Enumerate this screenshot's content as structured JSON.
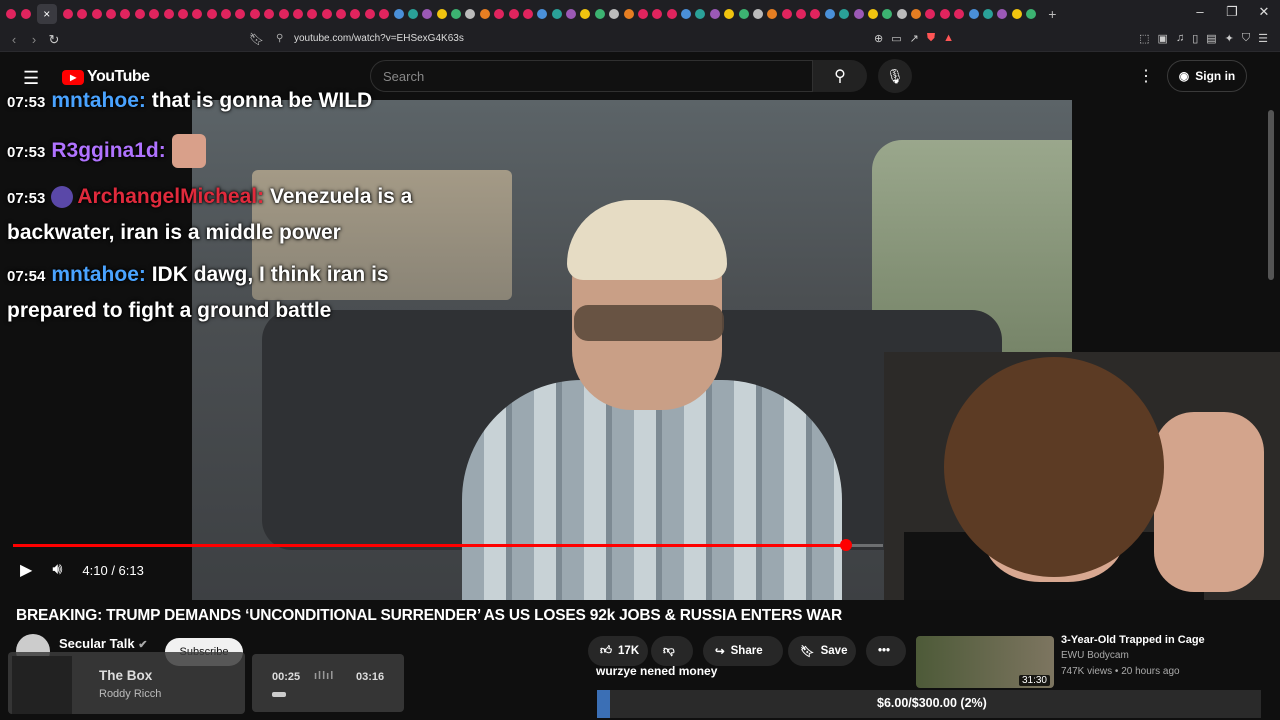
{
  "browser": {
    "tab_close": "×",
    "new_tab": "+",
    "url": "youtube.com/watch?v=EHSexG4K63s",
    "window_controls": [
      "–",
      "❐",
      "✕"
    ]
  },
  "header": {
    "logo_text": "YouTube",
    "search_placeholder": "Search",
    "signin_label": "Sign in"
  },
  "chat": [
    {
      "time": "07:53",
      "user": "mntahoe:",
      "message": "that is gonna be WILD",
      "color": "#4aa3ff"
    },
    {
      "time": "07:53",
      "user": "R3ggina1d:",
      "message": "",
      "color": "#b073ff"
    },
    {
      "time": "07:53",
      "user": "ArchangelMicheal:",
      "message": "Venezuela is a backwater, iran is a middle power",
      "color": "#e02a3c"
    },
    {
      "time": "07:54",
      "user": "mntahoe:",
      "message": "IDK dawg, I think iran is prepared to fight a ground battle",
      "color": "#4aa3ff"
    }
  ],
  "player": {
    "time_display": "4:10 / 6:13",
    "progress": 0.958
  },
  "video": {
    "title": "BREAKING: TRUMP DEMANDS ‘UNCONDITIONAL SURRENDER’ AS US LOSES 92k JOBS & RUSSIA ENTERS WAR",
    "channel": "Secular Talk",
    "subscribe_label": "Subscribe",
    "likes": "17K",
    "share_label": "Share",
    "save_label": "Save"
  },
  "overlay": {
    "song_title": "The Box",
    "song_artist": "Roddy Ricch",
    "time_start": "00:25",
    "time_end": "03:16",
    "ticker": "wurzye nened money",
    "donation": "$6.00/$300.00 (2%)",
    "donation_progress": 0.02
  },
  "recommendation": {
    "title": "3-Year-Old Trapped in Cage",
    "channel": "EWU Bodycam",
    "meta": "747K views • 20 hours ago",
    "duration": "31:30"
  }
}
